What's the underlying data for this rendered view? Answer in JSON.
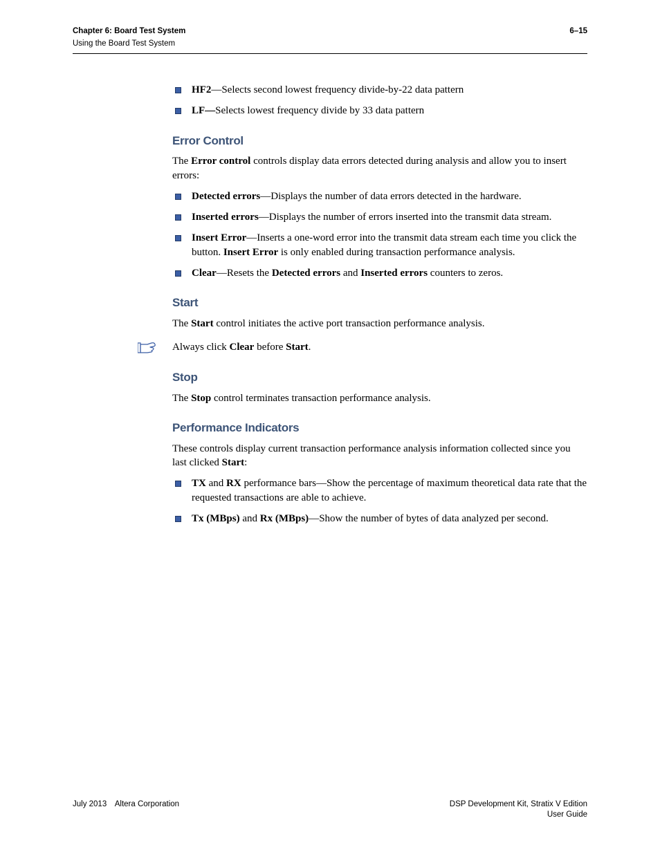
{
  "header": {
    "chapter": "Chapter 6: Board Test System",
    "sub": "Using the Board Test System",
    "pagenum": "6–15"
  },
  "intro_list": {
    "item1_bold": "HF2",
    "item1_rest": "—Selects second lowest frequency divide-by-22 data pattern",
    "item2_bold": "LF—",
    "item2_rest": "Selects lowest frequency divide by 33 data pattern"
  },
  "error_control": {
    "heading": "Error Control",
    "intro_pre": "The ",
    "intro_bold": "Error control",
    "intro_post": " controls display data errors detected during analysis and allow you to insert errors:",
    "li1_bold": "Detected errors",
    "li1_rest": "—Displays the number of data errors detected in the hardware.",
    "li2_bold": "Inserted errors",
    "li2_rest": "—Displays the number of errors inserted into the transmit data stream.",
    "li3_bold": "Insert Error",
    "li3_mid": "—Inserts a one-word error into the transmit data stream each time you click the button. ",
    "li3_bold2": "Insert Error",
    "li3_rest": " is only enabled during transaction performance analysis.",
    "li4_bold": "Clear",
    "li4_mid": "—Resets the ",
    "li4_bold2": "Detected errors",
    "li4_mid2": " and ",
    "li4_bold3": "Inserted errors",
    "li4_rest": " counters to zeros."
  },
  "start": {
    "heading": "Start",
    "intro_pre": "The ",
    "intro_bold": "Start",
    "intro_post": " control initiates the active port transaction performance analysis.",
    "note_pre": "Always click ",
    "note_bold1": "Clear",
    "note_mid": " before ",
    "note_bold2": "Start",
    "note_post": "."
  },
  "stop": {
    "heading": "Stop",
    "intro_pre": "The ",
    "intro_bold": "Stop",
    "intro_post": " control terminates transaction performance analysis."
  },
  "perf": {
    "heading": "Performance Indicators",
    "intro_pre": "These controls display current transaction performance analysis information collected since you last clicked ",
    "intro_bold": "Start",
    "intro_post": ":",
    "li1_bold1": "TX",
    "li1_mid1": " and ",
    "li1_bold2": "RX",
    "li1_rest": " performance bars—Show the percentage of maximum theoretical data rate that the requested transactions are able to achieve.",
    "li2_bold1": "Tx (MBps)",
    "li2_mid1": " and ",
    "li2_bold2": "Rx (MBps)",
    "li2_rest": "—Show the number of bytes of data analyzed per second."
  },
  "footer": {
    "left": "July 2013 Altera Corporation",
    "right_line1": "DSP Development Kit, Stratix V Edition",
    "right_line2": "User Guide"
  }
}
